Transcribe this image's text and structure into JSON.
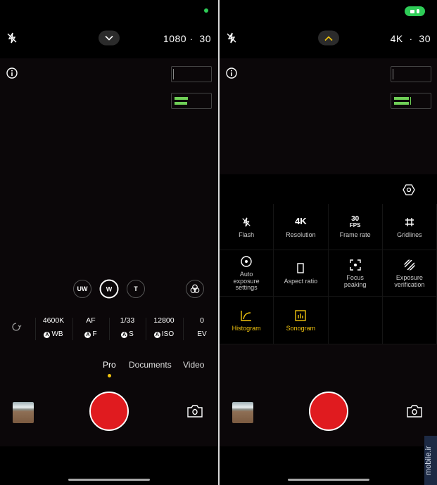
{
  "colors": {
    "accent": "#f1c40f",
    "record": "#e01b1f",
    "indicator": "#2ecc57"
  },
  "left": {
    "top": {
      "resolution": "1080",
      "separator": "·",
      "fps": "30"
    },
    "lenses": [
      "UW",
      "W",
      "T"
    ],
    "selected_lens": "W",
    "pro_params": [
      {
        "value": "4600K",
        "label": "WB",
        "auto": true
      },
      {
        "value": "AF",
        "label": "F",
        "auto": true
      },
      {
        "value": "1/33",
        "label": "S",
        "auto": true
      },
      {
        "value": "12800",
        "label": "ISO",
        "auto": true
      },
      {
        "value": "0",
        "label": "EV",
        "auto": false
      }
    ],
    "auto_badge": "A",
    "modes": [
      "Pro",
      "Documents",
      "Video"
    ],
    "active_mode": "Pro"
  },
  "right": {
    "top": {
      "resolution": "4K",
      "separator": "·",
      "fps": "30"
    },
    "quick_settings": [
      {
        "label": "Flash",
        "icon": "flash-off-icon",
        "active": false
      },
      {
        "label": "Resolution",
        "icon": "4K",
        "active": false
      },
      {
        "label": "Frame rate",
        "icon": "30 FPS",
        "active": false
      },
      {
        "label": "Gridlines",
        "icon": "grid-icon",
        "active": false
      },
      {
        "label": "Auto exposure settings",
        "icon": "auto-exposure-icon",
        "active": false
      },
      {
        "label": "Aspect ratio",
        "icon": "aspect-ratio-icon",
        "active": false
      },
      {
        "label": "Focus peaking",
        "icon": "focus-peaking-icon",
        "active": false
      },
      {
        "label": "Exposure verification",
        "icon": "zebra-icon",
        "active": false
      },
      {
        "label": "Histogram",
        "icon": "histogram-icon",
        "active": true
      },
      {
        "label": "Sonogram",
        "icon": "sonogram-icon",
        "active": true
      }
    ]
  },
  "watermark": "mobile.ir"
}
